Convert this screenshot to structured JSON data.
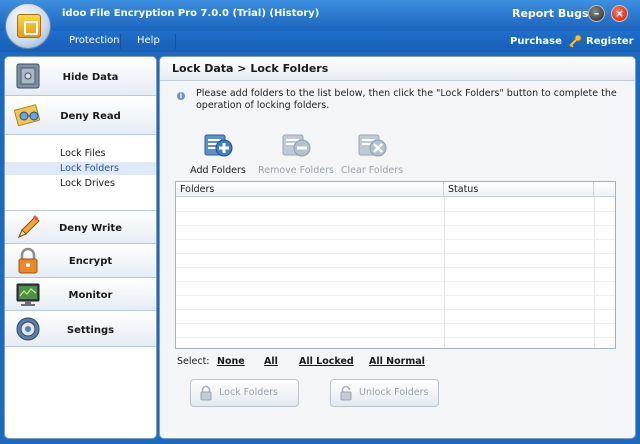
{
  "window": {
    "title": "idoo File Encryption Pro 7.0.0 (Trial)  (History)",
    "report_bugs": "Report Bugs",
    "minimize_symbol": "–",
    "close_symbol": "×"
  },
  "menu": {
    "items": [
      "Protection",
      "Help"
    ],
    "purchase": "Purchase",
    "register": "Register"
  },
  "sidebar": {
    "items": [
      {
        "label": "Hide Data",
        "icon": "safe-icon"
      },
      {
        "label": "Deny Read",
        "icon": "glasses-icon"
      },
      {
        "label": "Deny Write",
        "icon": "pencil-icon"
      },
      {
        "label": "Encrypt",
        "icon": "padlock-icon"
      },
      {
        "label": "Monitor",
        "icon": "monitor-icon"
      },
      {
        "label": "Settings",
        "icon": "gear-icon"
      }
    ],
    "submenu": [
      "Lock Files",
      "Lock Folders",
      "Lock Drives"
    ],
    "selected_submenu": "Lock Folders"
  },
  "main": {
    "breadcrumb": "Lock Data > Lock Folders",
    "instructions": "Please add folders to the list below, then click the \"Lock Folders\" button to complete the operation of locking folders.",
    "toolbar": {
      "add": "Add Folders",
      "remove": "Remove Folders",
      "clear": "Clear Folders"
    },
    "table": {
      "columns": [
        "Folders",
        "Status"
      ],
      "rows": []
    },
    "select": {
      "label": "Select:",
      "none": "None",
      "all": "All",
      "all_locked": "All Locked",
      "all_normal": "All Normal"
    },
    "actions": {
      "lock": "Lock Folders",
      "unlock": "Unlock Folders"
    }
  },
  "colors": {
    "titlebar": "#1b64bd",
    "menubar": "#1e6fcc",
    "selection": "#dfe9f7",
    "disabled_text": "#9aa3ad"
  }
}
